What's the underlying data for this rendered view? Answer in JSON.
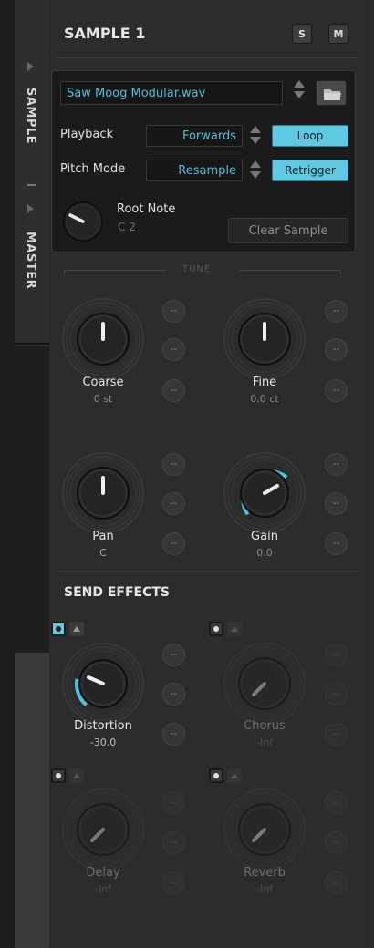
{
  "side_tabs": [
    {
      "label": "SAMPLE",
      "active": true
    },
    {
      "label": "MASTER",
      "active": false
    }
  ],
  "header": {
    "title": "SAMPLE 1",
    "solo_label": "S",
    "mute_label": "M"
  },
  "sample": {
    "file_name": "Saw Moog Modular.wav",
    "playback_label": "Playback",
    "playback_value": "Forwards",
    "loop_label": "Loop",
    "pitch_mode_label": "Pitch Mode",
    "pitch_mode_value": "Resample",
    "retrigger_label": "Retrigger",
    "root_note_label": "Root Note",
    "root_note_value": "C 2",
    "clear_label": "Clear Sample"
  },
  "tune": {
    "section_label": "TUNE",
    "knobs": [
      {
        "label": "Coarse",
        "value": "0 st"
      },
      {
        "label": "Fine",
        "value": "0.0 ct"
      },
      {
        "label": "Pan",
        "value": "C"
      },
      {
        "label": "Gain",
        "value": "0.0"
      }
    ]
  },
  "send_effects": {
    "title": "SEND EFFECTS",
    "effects": [
      {
        "label": "Distortion",
        "value": "-30.0",
        "enabled": true
      },
      {
        "label": "Chorus",
        "value": "-Inf",
        "enabled": false
      },
      {
        "label": "Delay",
        "value": "-Inf",
        "enabled": false
      },
      {
        "label": "Reverb",
        "value": "-Inf",
        "enabled": false
      }
    ]
  },
  "mod_slot_label": "--",
  "colors": {
    "accent": "#5fc9e2",
    "background": "#2c2c2c",
    "panel": "#1b1b1b"
  }
}
